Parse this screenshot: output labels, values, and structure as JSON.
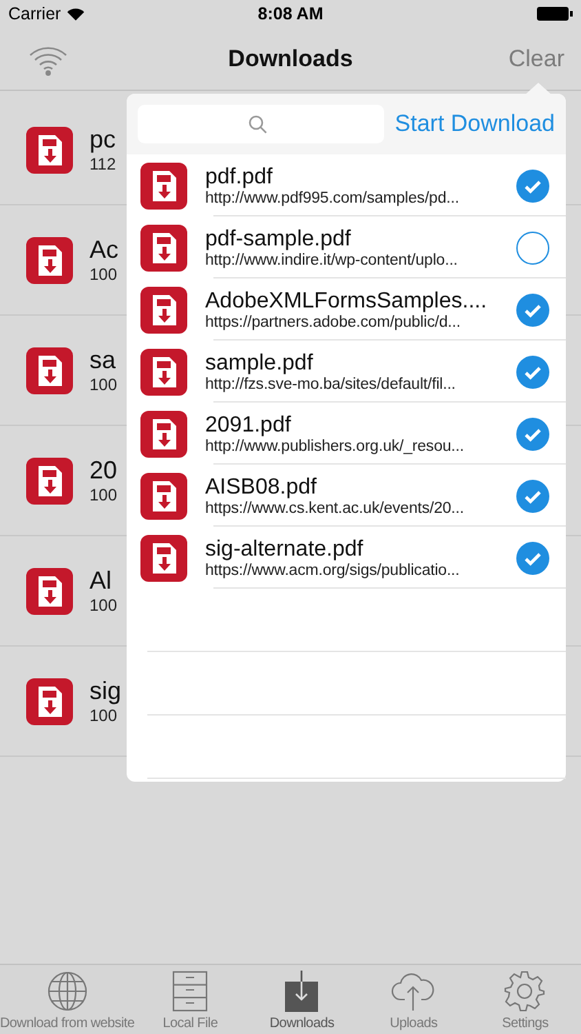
{
  "status_bar": {
    "carrier": "Carrier",
    "time": "8:08 AM"
  },
  "nav": {
    "title": "Downloads",
    "right_button": "Clear"
  },
  "files": [
    {
      "name": "pc",
      "size": "112"
    },
    {
      "name": "Ac",
      "size": "100"
    },
    {
      "name": "sa",
      "size": "100"
    },
    {
      "name": "20",
      "size": "100"
    },
    {
      "name": "Al",
      "size": "100"
    },
    {
      "name": "sig",
      "size": "100"
    }
  ],
  "popover": {
    "action": "Start Download",
    "items": [
      {
        "title": "pdf.pdf",
        "url": "http://www.pdf995.com/samples/pd...",
        "checked": true
      },
      {
        "title": "pdf-sample.pdf",
        "url": "http://www.indire.it/wp-content/uplo...",
        "checked": false
      },
      {
        "title": "AdobeXMLFormsSamples....",
        "url": "https://partners.adobe.com/public/d...",
        "checked": true
      },
      {
        "title": "sample.pdf",
        "url": "http://fzs.sve-mo.ba/sites/default/fil...",
        "checked": true
      },
      {
        "title": "2091.pdf",
        "url": "http://www.publishers.org.uk/_resou...",
        "checked": true
      },
      {
        "title": "AISB08.pdf",
        "url": "https://www.cs.kent.ac.uk/events/20...",
        "checked": true
      },
      {
        "title": "sig-alternate.pdf",
        "url": "https://www.acm.org/sigs/publicatio...",
        "checked": true
      }
    ]
  },
  "tabs": [
    {
      "label": "Download from website",
      "kind": "globe",
      "selected": false
    },
    {
      "label": "Local File",
      "kind": "cabinet",
      "selected": false
    },
    {
      "label": "Downloads",
      "kind": "download",
      "selected": true
    },
    {
      "label": "Uploads",
      "kind": "cloud",
      "selected": false
    },
    {
      "label": "Settings",
      "kind": "gear",
      "selected": false
    }
  ]
}
